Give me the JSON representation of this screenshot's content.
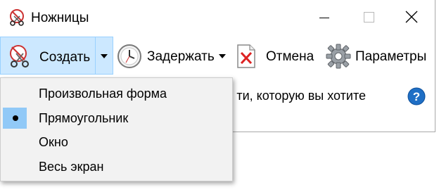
{
  "window": {
    "title": "Ножницы"
  },
  "toolbar": {
    "new_label": "Создать",
    "delay_label": "Задержать",
    "cancel_label": "Отмена",
    "options_label": "Параметры"
  },
  "instruction": {
    "text": "ти, которую вы хотите"
  },
  "menu": {
    "items": [
      {
        "label": "Произвольная форма",
        "selected": false
      },
      {
        "label": "Прямоугольник",
        "selected": true
      },
      {
        "label": "Окно",
        "selected": false
      },
      {
        "label": "Весь экран",
        "selected": false
      }
    ]
  },
  "colors": {
    "hover_bg": "#cce8ff",
    "hover_border": "#99d1ff",
    "selected_mark_bg": "#91c9f7",
    "help_blue": "#1f6fc5"
  },
  "icons": [
    "snipping-tool-icon",
    "minimize-icon",
    "maximize-icon",
    "close-icon",
    "scissors-icon",
    "chevron-down-icon",
    "clock-icon",
    "cancel-icon",
    "gear-icon",
    "help-icon",
    "bullet-icon"
  ]
}
